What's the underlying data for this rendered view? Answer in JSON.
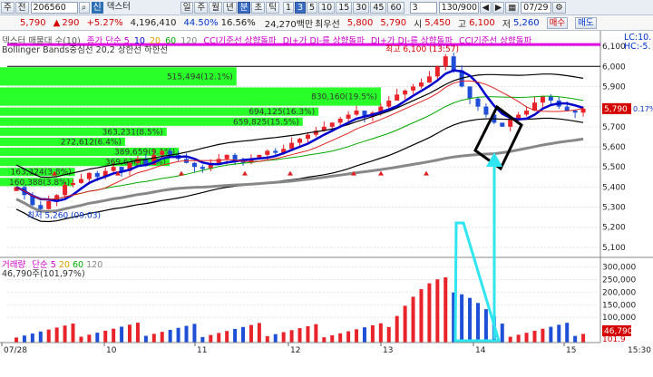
{
  "toolbar": {
    "menu_label": "주",
    "prev_label": "전",
    "stock_code": "206560",
    "trust_tag": "신",
    "stock_name": "덱스터",
    "period_buttons": [
      "일",
      "주",
      "월",
      "년",
      "분",
      "초",
      "틱"
    ],
    "selected_period": "분",
    "minute_buttons": [
      "1",
      "3",
      "5",
      "10",
      "15",
      "30",
      "45",
      "60"
    ],
    "selected_minute": "3",
    "count_value": "3",
    "range_value": "130/900",
    "date_value": "07/29"
  },
  "infobar": {
    "price": "5,790",
    "change_arrow": "▲",
    "change": "290",
    "change_pct": "+5.27%",
    "volume": "4,196,410",
    "turnover_pct": "44.50%",
    "ratio_pct": "16.56%",
    "amount": "24,270백만",
    "pref_label": "최우선",
    "pref_ask": "5,800",
    "pref_bid": "5,790",
    "open_label": "시",
    "open": "5,450",
    "high_label": "고",
    "high": "6,100",
    "low_label": "저",
    "low": "5,260",
    "buy_label": "매수",
    "sell_label": "매도"
  },
  "price_legend": {
    "line1": [
      "덱스터 매물대 수(10)",
      "종가 단순 5",
      "10",
      "20",
      "60",
      "120",
      "CCI기준선 상향돌파",
      "DI+가 DI-를 상향돌파",
      "DI+가 DI-를 상향돌파",
      "CCI기준선 상향돌파"
    ],
    "line2": "Bollinger Bands중심선 20,2 상한선 하한선",
    "right": [
      "LC:10.",
      "HC:-5."
    ]
  },
  "volume_legend": {
    "line1": [
      "거래량",
      "단순",
      "5",
      "20",
      "60",
      "120"
    ],
    "line2": "46,790주(101,97%)"
  },
  "annotations": {
    "high_label": "최고 6,100 (13:57)",
    "low_label": "최저 5,260 (09:03)"
  },
  "volume_profile": [
    {
      "label": "515,494(12.1%)",
      "from": 5900,
      "to": 6000,
      "value": 515494
    },
    {
      "label": "830,160(19.5%)",
      "from": 5800,
      "to": 5900,
      "value": 830160
    },
    {
      "label": "694,125(16.3%)",
      "from": 5750,
      "to": 5800,
      "value": 694125
    },
    {
      "label": "659,825(15.5%)",
      "from": 5700,
      "to": 5750,
      "value": 659825
    },
    {
      "label": "363,231(8.5%)",
      "from": 5650,
      "to": 5700,
      "value": 363231
    },
    {
      "label": "272,612(6.4%)",
      "from": 5600,
      "to": 5650,
      "value": 272612
    },
    {
      "label": "389,659(9.1%)",
      "from": 5550,
      "to": 5600,
      "value": 389659
    },
    {
      "label": "369,638(8.7%)",
      "from": 5500,
      "to": 5550,
      "value": 369638
    },
    {
      "label": "163,324(3.8%)",
      "from": 5450,
      "to": 5500,
      "value": 163324
    },
    {
      "label": "160,388(3.8%)",
      "from": 5400,
      "to": 5450,
      "value": 160388
    }
  ],
  "chart_data": {
    "type": "candlestick",
    "x_dates": [
      "07/28",
      "10",
      "11",
      "12",
      "13",
      "14",
      "15",
      "15:30"
    ],
    "y_ticks": [
      "6,100",
      "6,000",
      "5,900",
      "5,800",
      "5,700",
      "5,600",
      "5,500",
      "5,400",
      "5,300",
      "5,200",
      "5,100"
    ],
    "ylim": [
      5050,
      6150
    ],
    "last_price": "5,790",
    "last_pct": "0.17%",
    "volume_ticks": [
      "300,000",
      "250,000",
      "200,000",
      "150,000",
      "100,000"
    ],
    "volume_ylim": [
      0,
      320000
    ],
    "volume_last": "46,790",
    "volume_last_pct": "101.9",
    "closes": [
      5400,
      5360,
      5310,
      5290,
      5330,
      5360,
      5410,
      5420,
      5440,
      5470,
      5450,
      5480,
      5500,
      5480,
      5520,
      5540,
      5510,
      5560,
      5580,
      5560,
      5540,
      5520,
      5500,
      5490,
      5520,
      5540,
      5560,
      5530,
      5520,
      5540,
      5560,
      5580,
      5570,
      5590,
      5620,
      5640,
      5660,
      5680,
      5700,
      5720,
      5740,
      5760,
      5780,
      5750,
      5770,
      5800,
      5830,
      5860,
      5880,
      5900,
      5920,
      5950,
      6000,
      6050,
      5980,
      5900,
      5840,
      5800,
      5760,
      5720,
      5700,
      5740,
      5760,
      5780,
      5820,
      5850,
      5830,
      5800,
      5780,
      5770,
      5790
    ]
  },
  "colors": {
    "up": "#e8232a",
    "down": "#1f4fd6",
    "profile": "#1dff1d",
    "bollinger": "#000000",
    "ma5": "#0000cc",
    "ma20": "#e0a000",
    "ma60": "#00aa00",
    "ma120": "#888888",
    "highline": "#e000e0",
    "arrow": "#2fe5f0"
  }
}
